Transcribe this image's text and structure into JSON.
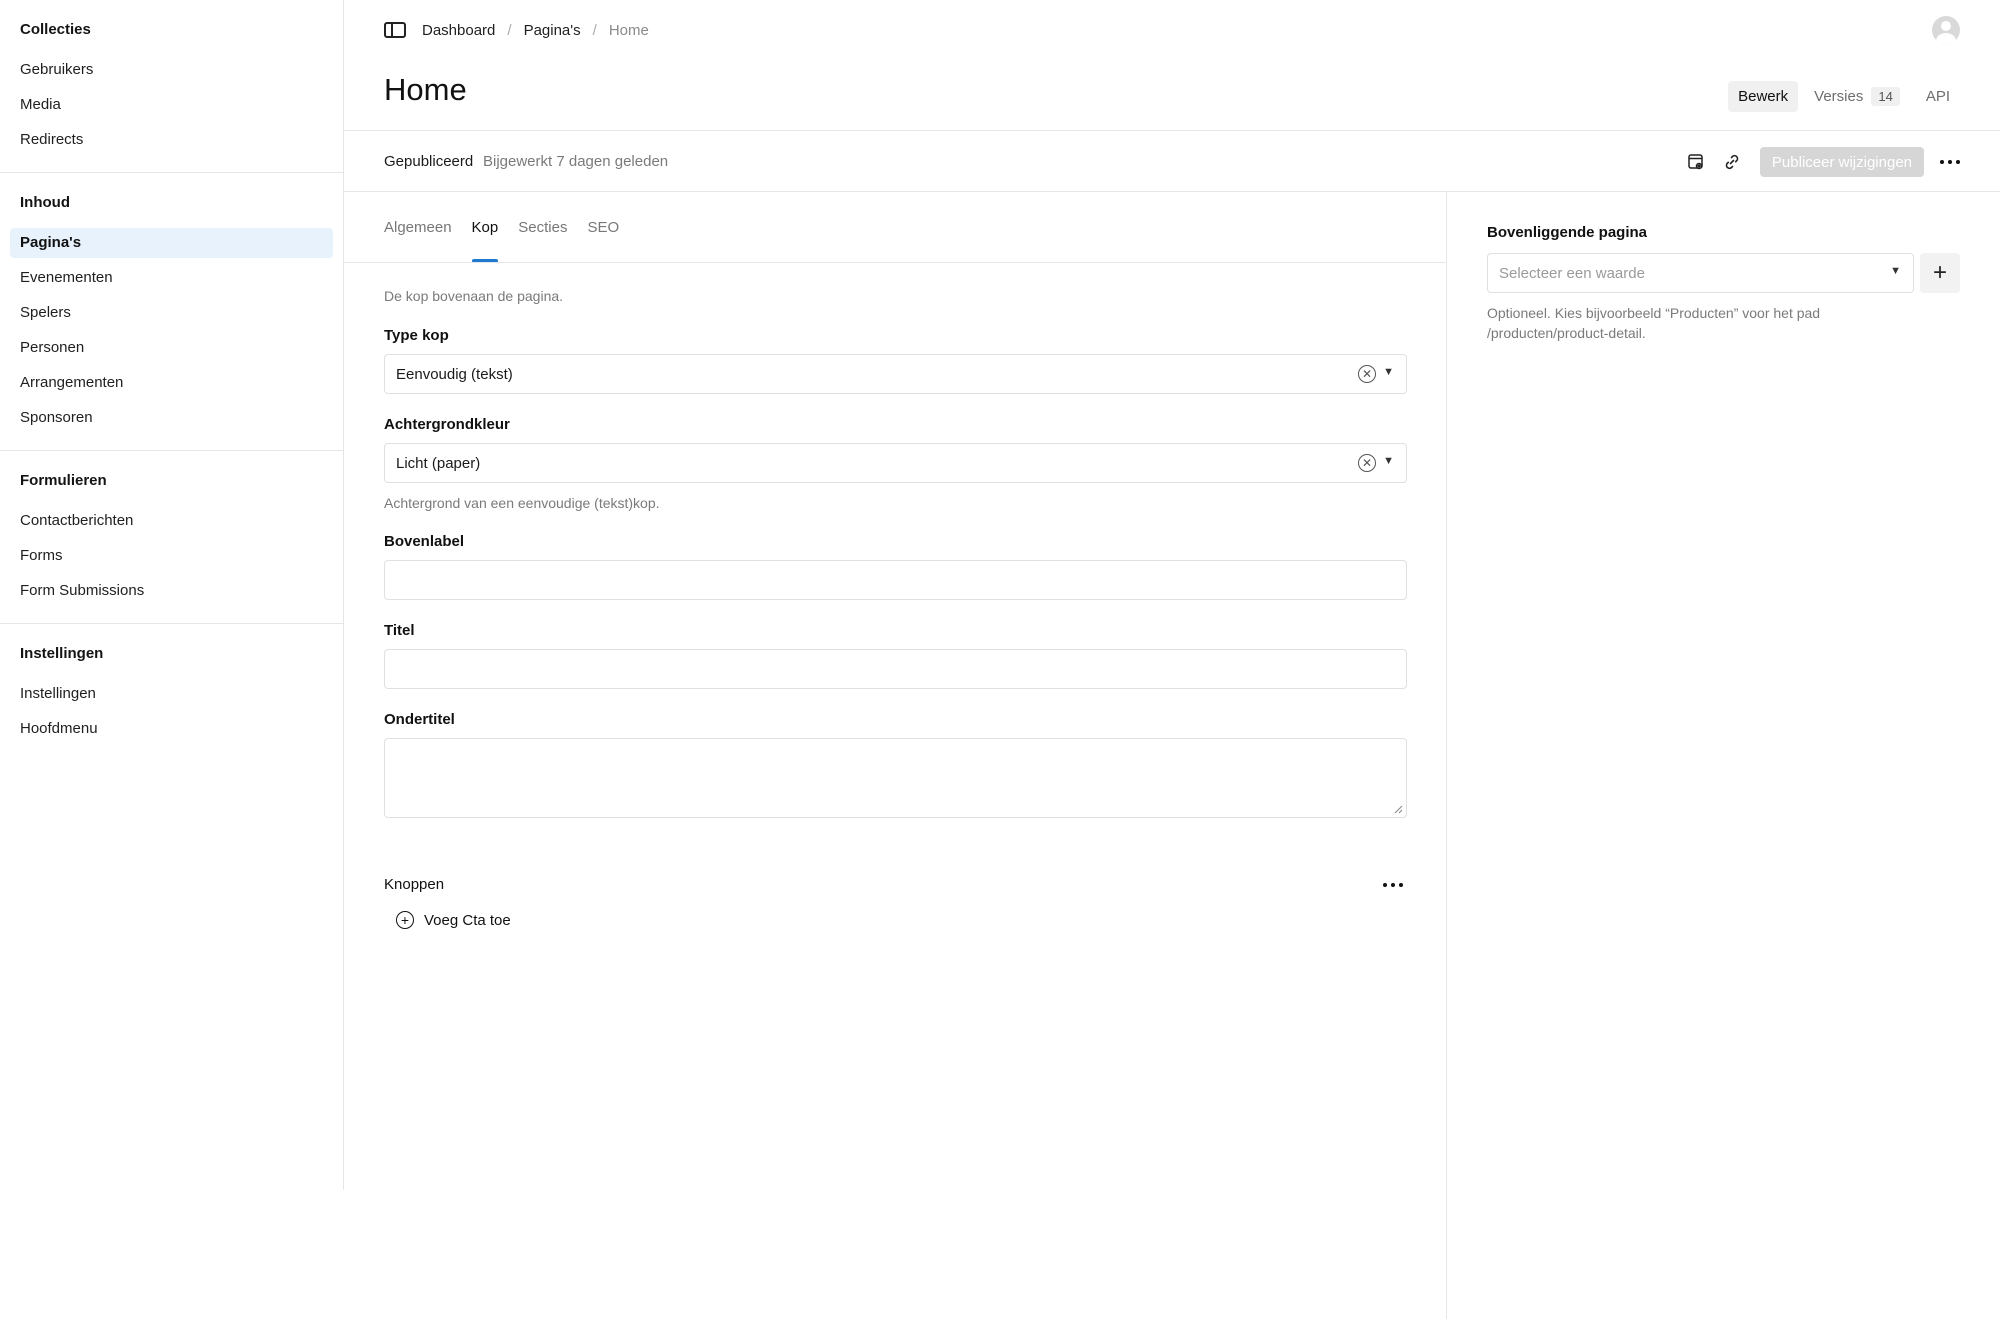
{
  "sidebar": {
    "groups": [
      {
        "heading": "Collecties",
        "items": [
          "Gebruikers",
          "Media",
          "Redirects"
        ]
      },
      {
        "heading": "Inhoud",
        "items": [
          "Pagina's",
          "Evenementen",
          "Spelers",
          "Personen",
          "Arrangementen",
          "Sponsoren"
        ]
      },
      {
        "heading": "Formulieren",
        "items": [
          "Contactberichten",
          "Forms",
          "Form Submissions"
        ]
      },
      {
        "heading": "Instellingen",
        "items": [
          "Instellingen",
          "Hoofdmenu"
        ]
      }
    ],
    "active_item": "Pagina's"
  },
  "breadcrumb": {
    "items": [
      "Dashboard",
      "Pagina's",
      "Home"
    ],
    "separator": "/"
  },
  "page": {
    "title": "Home",
    "view_tabs": {
      "edit": "Bewerk",
      "versions": "Versies",
      "versions_count": "14",
      "api": "API"
    }
  },
  "status": {
    "label": "Gepubliceerd",
    "updated": "Bijgewerkt 7 dagen geleden",
    "publish_button": "Publiceer wijzigingen"
  },
  "tabs": {
    "items": [
      "Algemeen",
      "Kop",
      "Secties",
      "SEO"
    ],
    "active": "Kop"
  },
  "form": {
    "description": "De kop bovenaan de pagina.",
    "type_kop": {
      "label": "Type kop",
      "value": "Eenvoudig (tekst)"
    },
    "achtergrondkleur": {
      "label": "Achtergrondkleur",
      "value": "Licht (paper)",
      "helper": "Achtergrond van een eenvoudige (tekst)kop."
    },
    "bovenlabel": {
      "label": "Bovenlabel",
      "value": ""
    },
    "titel": {
      "label": "Titel",
      "value": ""
    },
    "ondertitel": {
      "label": "Ondertitel",
      "value": ""
    },
    "knoppen": {
      "label": "Knoppen",
      "add_label": "Voeg Cta toe"
    }
  },
  "side": {
    "label": "Bovenliggende pagina",
    "placeholder": "Selecteer een waarde",
    "helper": "Optioneel. Kies bijvoorbeeld “Producten” voor het pad /producten/product-detail."
  },
  "colors": {
    "accent": "#1f7ad1",
    "active_nav_bg": "#e8f2fc",
    "border": "#e6e6e6",
    "muted_text": "#7a7a7a"
  }
}
